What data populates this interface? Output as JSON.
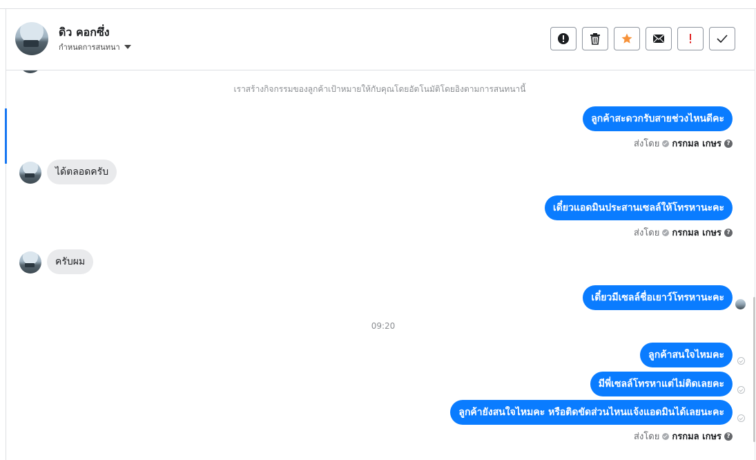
{
  "header": {
    "contact_name": "ดิว คอกซึ่ง",
    "assign_label": "กำหนดการสนทนา",
    "actions": [
      {
        "icon": "alert-circle-icon"
      },
      {
        "icon": "trash-icon"
      },
      {
        "icon": "star-icon",
        "color": "#f7923a"
      },
      {
        "icon": "mail-icon"
      },
      {
        "icon": "exclamation-icon",
        "color": "#e02020"
      },
      {
        "icon": "check-icon"
      }
    ]
  },
  "conversation": {
    "system_notice": "เราสร้างกิจกรรมของลูกค้าเป้าหมายให้กับคุณโดยอัตโนมัติโดยอิงตามการสนทนานี้",
    "messages": [
      {
        "text": "ลูกค้าสะดวกรับสายช่วงไหนดีคะ"
      },
      {
        "text": "ได้ตลอดครับ"
      },
      {
        "text": "เดี๋ยวแอดมินประสานเซลล์ให้โทรหานะคะ"
      },
      {
        "text": "ครับผม"
      },
      {
        "text": "เดี๋ยวมีเซลล์ชื่อเยาว์โทรหานะคะ"
      },
      {
        "text": "ลูกค้าสนใจไหมคะ"
      },
      {
        "text": "มีพี่เซลล์โทรหาแต่ไม่ติดเลยคะ"
      },
      {
        "text": "ลูกค้ายังสนใจไหมคะ หรือติดขัดส่วนไหนแจ้งแอดมินได้เลยนะคะ"
      }
    ],
    "time_divider": "09:20",
    "sent_by_label": "ส่งโดย",
    "sent_by_name": "กรกมล เกษร",
    "help_glyph": "?"
  },
  "colors": {
    "outgoing_bubble": "#0a7cff",
    "incoming_bubble": "#e9eaec",
    "accent": "#1877f2"
  }
}
